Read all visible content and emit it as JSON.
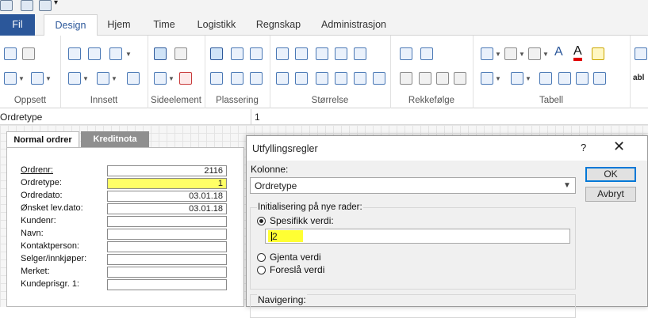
{
  "ribbon": {
    "tabs": [
      {
        "label": "Fil"
      },
      {
        "label": "Design"
      },
      {
        "label": "Hjem"
      },
      {
        "label": "Time"
      },
      {
        "label": "Logistikk"
      },
      {
        "label": "Regnskap"
      },
      {
        "label": "Administrasjon"
      }
    ],
    "active_tab": "Design",
    "groups": [
      {
        "label": "Oppsett"
      },
      {
        "label": "Innsett"
      },
      {
        "label": "Sideelement"
      },
      {
        "label": "Plassering"
      },
      {
        "label": "Størrelse"
      },
      {
        "label": "Rekkefølge"
      },
      {
        "label": "Tabell"
      }
    ],
    "text_button_label": "abl",
    "accent_color": "#2b579a"
  },
  "formula_bar": {
    "field_name": "Ordretype",
    "field_value": "1"
  },
  "form": {
    "tabs": [
      {
        "label": "Normal ordrer"
      },
      {
        "label": "Kreditnota"
      }
    ],
    "fields": [
      {
        "label": "Ordrenr:",
        "value": "2116"
      },
      {
        "label": "Ordretype:",
        "value": "1"
      },
      {
        "label": "Ordredato:",
        "value": "03.01.18"
      },
      {
        "label": "Ønsket lev.dato:",
        "value": "03.01.18"
      },
      {
        "label": "Kundenr:",
        "value": ""
      },
      {
        "label": "Navn:",
        "value": ""
      },
      {
        "label": "Kontaktperson:",
        "value": ""
      },
      {
        "label": "Selger/innkjøper:",
        "value": ""
      },
      {
        "label": "Merket:",
        "value": ""
      },
      {
        "label": "Kundeprisgr. 1:",
        "value": ""
      }
    ],
    "highlight_color": "#ffff66"
  },
  "dialog": {
    "title": "Utfyllingsregler",
    "help_label": "?",
    "close_label": "✕",
    "kolonne_label": "Kolonne:",
    "kolonne_value": "Ordretype",
    "init_group_label": "Initialisering på nye rader:",
    "radio_specific": "Spesifikk verdi:",
    "specific_value": "2",
    "radio_gjenta": "Gjenta verdi",
    "radio_foresla": "Foreslå verdi",
    "nav_group_label": "Navigering:",
    "ok_label": "OK",
    "cancel_label": "Avbryt"
  }
}
